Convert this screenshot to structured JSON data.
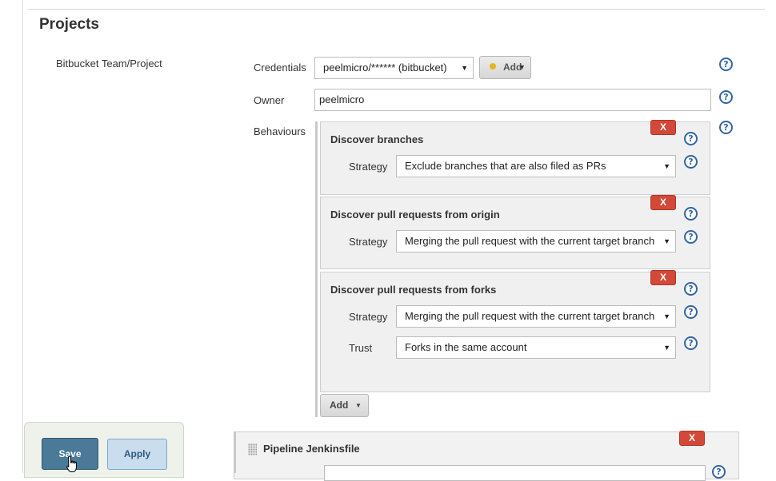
{
  "section": {
    "title": "Projects"
  },
  "source": {
    "label": "Bitbucket Team/Project",
    "credentials": {
      "label": "Credentials",
      "value": "peelmicro/****** (bitbucket)",
      "add_label": "Add"
    },
    "owner": {
      "label": "Owner",
      "value": "peelmicro"
    },
    "behaviours": {
      "label": "Behaviours",
      "items": [
        {
          "title": "Discover branches",
          "remove_label": "X",
          "fields": [
            {
              "label": "Strategy",
              "value": "Exclude branches that are also filed as PRs"
            }
          ]
        },
        {
          "title": "Discover pull requests from origin",
          "remove_label": "X",
          "fields": [
            {
              "label": "Strategy",
              "value": "Merging the pull request with the current target branch"
            }
          ]
        },
        {
          "title": "Discover pull requests from forks",
          "remove_label": "X",
          "fields": [
            {
              "label": "Strategy",
              "value": "Merging the pull request with the current target branch"
            },
            {
              "label": "Trust",
              "value": "Forks in the same account"
            }
          ]
        }
      ],
      "add_label": "Add"
    }
  },
  "pipeline": {
    "title": "Pipeline Jenkinsfile",
    "remove_label": "X"
  },
  "footer": {
    "save_label": "Save",
    "apply_label": "Apply"
  },
  "help_label": "?",
  "icons": {
    "help": "help-icon",
    "dropdown": "chevron-down-icon",
    "key": "key-icon",
    "drag": "drag-handle-icon",
    "cursor": "hand-cursor-icon"
  },
  "colors": {
    "remove": "#d24939",
    "save": "#4a7a97",
    "apply": "#c9ddef",
    "help": "#3465a4"
  }
}
